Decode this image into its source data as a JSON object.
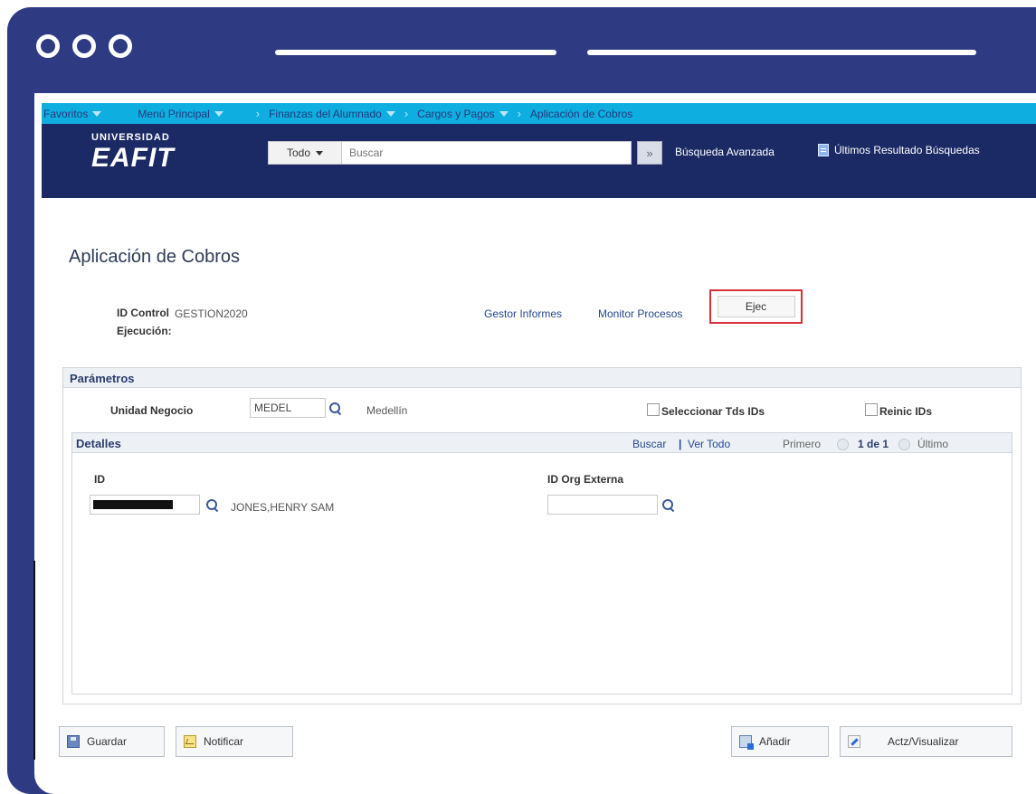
{
  "nav": {
    "items": [
      {
        "label": "Favoritos"
      },
      {
        "label": "Menú Principal"
      },
      {
        "label": "Finanzas del Alumnado"
      },
      {
        "label": "Cargos y Pagos"
      },
      {
        "label": "Aplicación de Cobros"
      }
    ]
  },
  "header": {
    "logo_small": "UNIVERSIDAD",
    "logo_big": "EAFIT",
    "scope": "Todo",
    "search_placeholder": "Buscar",
    "go_symbol": "»",
    "advanced": "Búsqueda Avanzada",
    "last_results": "Últimos Resultado Búsquedas"
  },
  "page": {
    "title": "Aplicación de Cobros",
    "control_label_1": "ID Control",
    "control_label_2": "Ejecución:",
    "control_value": "GESTION2020",
    "gestor": "Gestor Informes",
    "monitor": "Monitor Procesos",
    "ejec": "Ejec"
  },
  "params": {
    "title": "Parámetros",
    "unidad_label": "Unidad Negocio",
    "unidad_value": "MEDEL",
    "unidad_desc": "Medellín",
    "select_all": "Seleccionar Tds IDs",
    "reset_ids": "Reinic IDs"
  },
  "details": {
    "title": "Detalles",
    "search": "Buscar",
    "divider": "|",
    "view_all": "Ver Todo",
    "first": "Primero",
    "count": "1 de 1",
    "last": "Último",
    "id_label": "ID",
    "org_label": "ID Org Externa",
    "name": "JONES,HENRY SAM"
  },
  "buttons": {
    "save": "Guardar",
    "notify": "Notificar",
    "add": "Añadir",
    "update": "Actz/Visualizar"
  }
}
